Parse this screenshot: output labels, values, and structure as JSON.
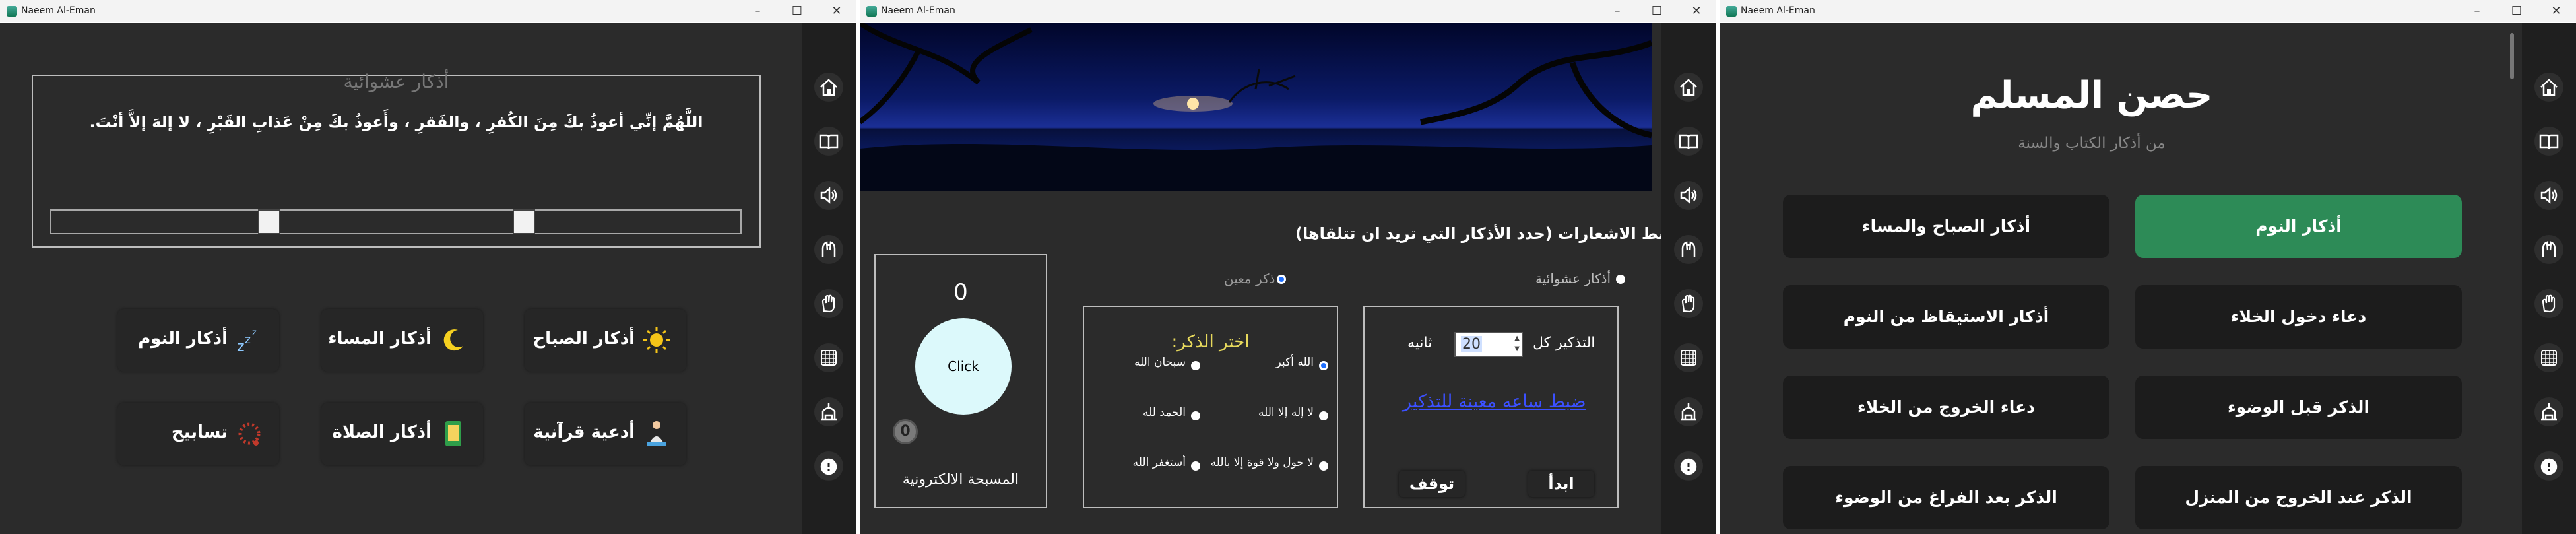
{
  "windows": [
    {
      "title": "Naeem Al-Eman"
    },
    {
      "title": "Naeem Al-Eman"
    },
    {
      "title": "Naeem Al-Eman"
    }
  ],
  "controls": {
    "minimize": "–",
    "maximize": "☐",
    "close": "✕"
  },
  "sidebar_icons": [
    "home-icon",
    "quran-icon",
    "audio-icon",
    "dua-hands-icon",
    "hand-icon",
    "prayer-beads-icon",
    "mosque-icon",
    "alarm-icon"
  ],
  "w1": {
    "random_title": "أذكار عشوائية",
    "random_text": "اللَّهُمَّ إنِّي أعوذُ بكَ مِنَ الكُفرِ ، والفَقرِ ، وأَعوذُ بكَ مِنْ عَذابِ القَبْرِ ، لا إلهَ إلاَّ أنْتَ.",
    "slider": {
      "value_a": 0.3,
      "value_b": 0.67
    },
    "tiles": [
      {
        "label": "أذكار الصباح",
        "icon": "sun-icon"
      },
      {
        "label": "أذكار المساء",
        "icon": "moon-icon"
      },
      {
        "label": "أذكار النوم",
        "icon": "sleep-zzz-icon"
      },
      {
        "label": "أدعية قرآنية",
        "icon": "praying-person-icon"
      },
      {
        "label": "أذكار الصلاة",
        "icon": "prayer-book-icon"
      },
      {
        "label": "تسابيح",
        "icon": "prayer-beads-icon"
      }
    ]
  },
  "w2": {
    "heading": "ضبط الاشعارات (حدد الأذكار التي تريد ان تتلقاها)",
    "opt_random": "أذكار عشوائية",
    "opt_specific": "ذكر معين",
    "counter_value": "0",
    "click_label": "Click",
    "reset_value": "0",
    "tasbeeh_label": "المسبحة الالكترونية",
    "choose_title": "اختر الذكر:",
    "dhikr_options": [
      "الله أكبر",
      "سبحان الله",
      "لا إله إلا الله",
      "الحمد لله",
      "لا حول ولا قوة إلا بالله",
      "أستغفر الله"
    ],
    "dhikr_selected": "الله أكبر",
    "repeat_label": "التذكير كل",
    "repeat_value": "20",
    "repeat_unit": "ثانيه",
    "link_text": "ضبط ساعه معينة للتذكير",
    "start_label": "ابدأ",
    "stop_label": "توقف"
  },
  "w3": {
    "title": "حصن المسلم",
    "subtitle": "من أذكار الكتاب والسنة",
    "buttons": [
      {
        "label": "أذكار النوم",
        "active": true
      },
      {
        "label": "أذكار الصباح والمساء",
        "active": false
      },
      {
        "label": "دعاء دخول الخلاء",
        "active": false
      },
      {
        "label": "أذكار الاستيقاظ من النوم",
        "active": false
      },
      {
        "label": "الذكر قبل الوضوء",
        "active": false
      },
      {
        "label": "دعاء الخروج من الخلاء",
        "active": false
      },
      {
        "label": "الذكر عند الخروج من المنزل",
        "active": false
      },
      {
        "label": "الذكر بعد الفراغ من الوضوء",
        "active": false
      }
    ]
  },
  "colors": {
    "bg": "#2b2b2b",
    "sidebar": "#1f1f1f",
    "accent_green": "#2d8b57",
    "link": "#3b50ff",
    "choose_title": "#e6d85c"
  }
}
